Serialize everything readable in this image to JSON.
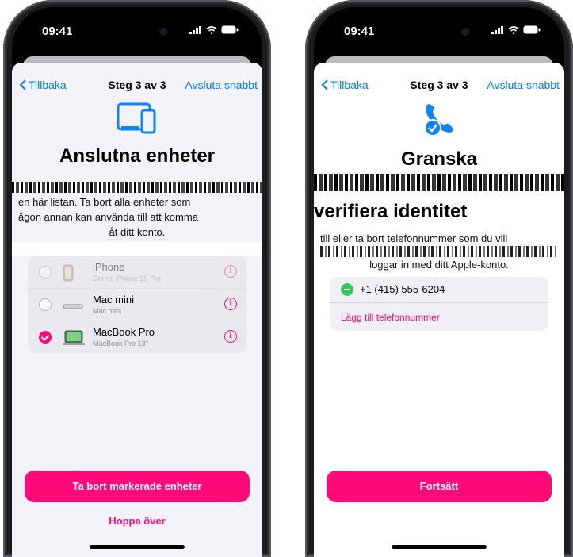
{
  "status": {
    "time": "09:41"
  },
  "nav": {
    "back": "Tillbaka",
    "step": "Steg 3 av 3",
    "quit": "Avsluta snabbt"
  },
  "left": {
    "heading": "Anslutna enheter",
    "body_line1": "en här listan. Ta bort alla enheter som",
    "body_line2": "ågon annan kan använda till att komma",
    "body_line3": "åt ditt konto.",
    "devices": [
      {
        "name": "iPhone",
        "sub": "Denna iPhone 15 Pro",
        "selected": false,
        "icon": "iphone-icon"
      },
      {
        "name": "Mac mini",
        "sub": "Mac mini",
        "selected": false,
        "icon": "mac-mini-icon"
      },
      {
        "name": "MacBook Pro",
        "sub": "MacBook Pro 13\"",
        "selected": true,
        "icon": "macbook-icon"
      }
    ],
    "primary_button": "Ta bort markerade enheter",
    "secondary_link": "Hoppa över"
  },
  "right": {
    "heading_line1": "Granska",
    "heading_line3": "verifiera identitet",
    "body_line1": "till eller ta bort telefonnummer som du vill",
    "body_line3": "loggar in med ditt Apple-konto.",
    "phone_number": "+1 (415) 555-6204",
    "add_link": "Lägg till telefonnummer",
    "primary_button": "Fortsätt"
  },
  "colors": {
    "accent": "#ff0a78",
    "link": "#007aff",
    "green": "#34c759"
  }
}
